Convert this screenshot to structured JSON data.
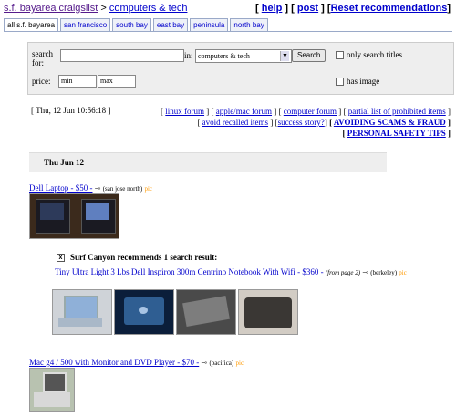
{
  "header": {
    "breadcrumb_home": "s.f. bayarea craigslist",
    "breadcrumb_sep": " > ",
    "breadcrumb_category": "computers & tech",
    "help": "help",
    "post": "post",
    "reset": "Reset recommendations"
  },
  "tabs": [
    "all s.f. bayarea",
    "san francisco",
    "south bay",
    "east bay",
    "peninsula",
    "north bay"
  ],
  "search": {
    "label": "search for:",
    "query": "",
    "in_label": "in:",
    "category": "computers & tech",
    "button": "Search",
    "only_titles": "only search titles",
    "price_label": "price:",
    "min_placeholder": "min",
    "max_placeholder": "max",
    "has_image": "has image"
  },
  "date_stamp": "[ Thu, 12 Jun 10:56:18 ]",
  "info_links": {
    "linux": "linux forum",
    "apple": "apple/mac forum",
    "computer": "computer forum",
    "prohibited": "partial list of prohibited items",
    "recalled": "avoid recalled items",
    "success": "success story?",
    "scams": "AVOIDING SCAMS & FRAUD",
    "safety": "PERSONAL SAFETY TIPS"
  },
  "day_header": "Thu Jun 12",
  "posts": [
    {
      "title": "Dell Laptop - $50 -",
      "location": "(san jose north)",
      "pic": "pic"
    },
    {
      "title": "Mac g4 / 500 with Monitor and DVD Player - $70 -",
      "location": "(pacifica)",
      "pic": "pic"
    }
  ],
  "surf_canyon": {
    "close": "x",
    "heading": "Surf Canyon recommends 1 search result:",
    "title": "Tiny Ultra Light 3 Lbs Dell Inspiron 300m Centrino Notebook With Wifi - $360 -",
    "from_page": "(from page 2)",
    "location": "(berkeley)",
    "pic": "pic"
  },
  "colors": {
    "link": "#0000cc",
    "visited": "#551a8b",
    "pic": "#ff9900",
    "panel": "#eeeeee",
    "tab_border": "#9aa9c8"
  },
  "icons": {
    "map": "map-arrow-icon",
    "close": "close-x-icon",
    "dropdown": "chevron-down-icon"
  }
}
